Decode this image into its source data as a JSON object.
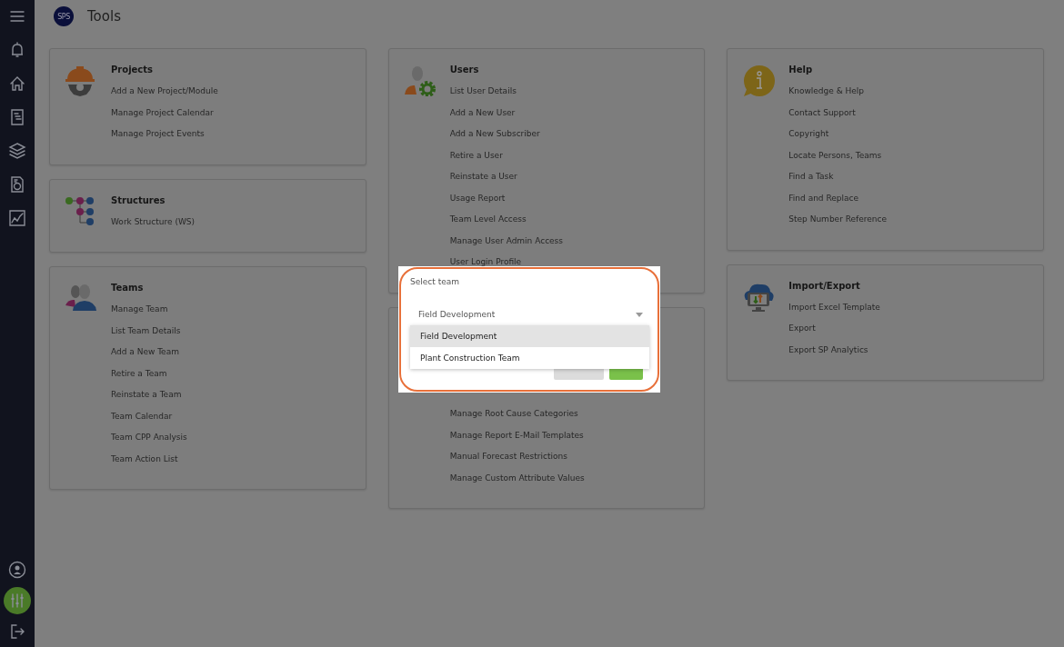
{
  "header": {
    "logo": "SPS",
    "title": "Tools"
  },
  "columns": [
    [
      {
        "title": "Projects",
        "items": [
          "Add a New Project/Module",
          "Manage Project Calendar",
          "Manage Project Events"
        ]
      },
      {
        "title": "Structures",
        "items": [
          "Work Structure (WS)"
        ]
      },
      {
        "title": "Teams",
        "items": [
          "Manage Team",
          "List Team Details",
          "Add a New Team",
          "Retire a Team",
          "Reinstate a Team",
          "Team Calendar",
          "Team CPP Analysis",
          "Team Action List"
        ]
      }
    ],
    [
      {
        "title": "Users",
        "items": [
          "List User Details",
          "Add a New User",
          "Add a New Subscriber",
          "Retire a User",
          "Reinstate a User",
          "Usage Report",
          "Team Level Access",
          "Manage User Admin Access",
          "User Login Profile"
        ]
      },
      {
        "items": [
          "Manage Root Cause Categories",
          "Manage Report E-Mail Templates",
          "Manual Forecast Restrictions",
          "Manage Custom Attribute Values"
        ]
      }
    ],
    [
      {
        "title": "Help",
        "items": [
          "Knowledge & Help",
          "Contact Support",
          "Copyright",
          "Locate Persons, Teams",
          "Find a Task",
          "Find and Replace",
          "Step Number Reference"
        ]
      },
      {
        "title": "Import/Export",
        "items": [
          "Import Excel Template",
          "Export",
          "Export SP Analytics"
        ]
      }
    ]
  ],
  "dialog": {
    "title": "Select team",
    "select": {
      "value": "Field Development"
    },
    "options": [
      {
        "label": "Field Development",
        "selected": true
      },
      {
        "label": "Plant Construction Team",
        "selected": false
      }
    ],
    "buttons": [
      {
        "kind": "secondary"
      },
      {
        "kind": "primary"
      }
    ]
  }
}
